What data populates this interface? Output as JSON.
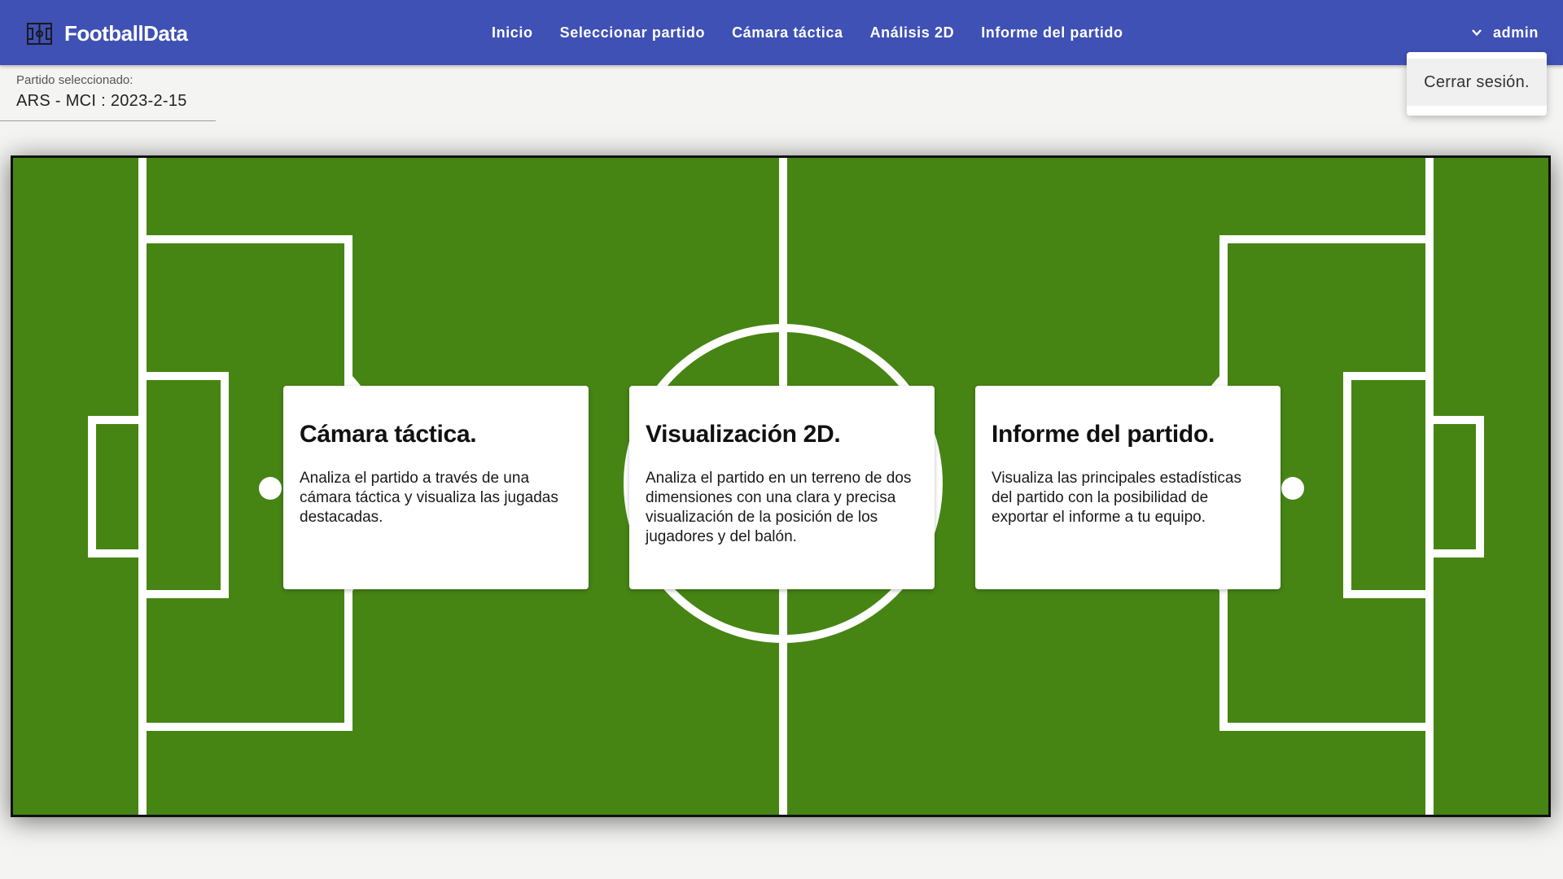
{
  "app": {
    "brand": "FootballData",
    "brand_icon": "pitch-icon",
    "colors": {
      "header": "#3f51b5",
      "pitch": "#468514",
      "lines": "#ffffff",
      "background": "#f4f4f2"
    }
  },
  "nav": {
    "items": [
      {
        "label": "Inicio"
      },
      {
        "label": "Seleccionar partido"
      },
      {
        "label": "Cámara táctica"
      },
      {
        "label": "Análisis 2D"
      },
      {
        "label": "Informe del partido"
      }
    ]
  },
  "user": {
    "name": "admin",
    "icon": "chevron-down-icon"
  },
  "user_menu": {
    "logout_label": "Cerrar sesión."
  },
  "match": {
    "label": "Partido seleccionado:",
    "value": "ARS - MCI : 2023-2-15"
  },
  "cards": [
    {
      "title": "Cámara táctica.",
      "text": "Analiza el partido a través de una cámara táctica y visualiza las jugadas destacadas."
    },
    {
      "title": "Visualización 2D.",
      "text": "Analiza el partido en un terreno de dos dimensiones con una clara y precisa visualización de la posición de los jugadores y del balón."
    },
    {
      "title": "Informe del partido.",
      "text": "Visualiza las principales estadísticas del partido con la posibilidad de exportar el informe a tu equipo."
    }
  ]
}
